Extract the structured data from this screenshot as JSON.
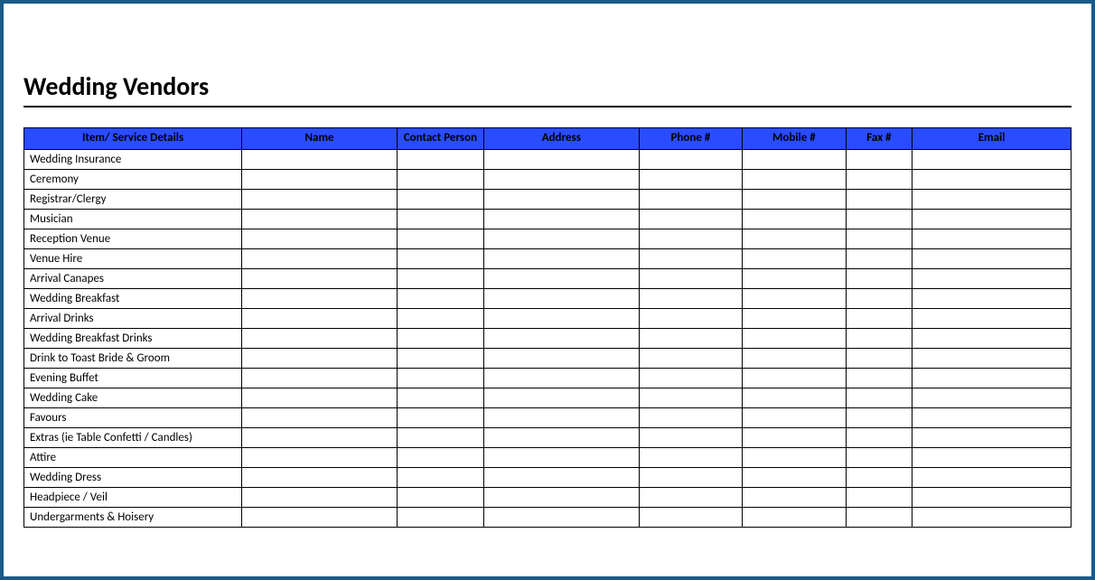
{
  "title": "Wedding Vendors",
  "headers": {
    "item": "Item/ Service Details",
    "name": "Name",
    "contact": "Contact Person",
    "address": "Address",
    "phone": "Phone #",
    "mobile": "Mobile #",
    "fax": "Fax #",
    "email": "Email"
  },
  "rows": [
    {
      "item": "Wedding Insurance",
      "name": "",
      "contact": "",
      "address": "",
      "phone": "",
      "mobile": "",
      "fax": "",
      "email": ""
    },
    {
      "item": "Ceremony",
      "name": "",
      "contact": "",
      "address": "",
      "phone": "",
      "mobile": "",
      "fax": "",
      "email": ""
    },
    {
      "item": "Registrar/Clergy",
      "name": "",
      "contact": "",
      "address": "",
      "phone": "",
      "mobile": "",
      "fax": "",
      "email": ""
    },
    {
      "item": "Musician",
      "name": "",
      "contact": "",
      "address": "",
      "phone": "",
      "mobile": "",
      "fax": "",
      "email": ""
    },
    {
      "item": "Reception Venue",
      "name": "",
      "contact": "",
      "address": "",
      "phone": "",
      "mobile": "",
      "fax": "",
      "email": ""
    },
    {
      "item": "Venue Hire",
      "name": "",
      "contact": "",
      "address": "",
      "phone": "",
      "mobile": "",
      "fax": "",
      "email": ""
    },
    {
      "item": "Arrival Canapes",
      "name": "",
      "contact": "",
      "address": "",
      "phone": "",
      "mobile": "",
      "fax": "",
      "email": ""
    },
    {
      "item": "Wedding Breakfast",
      "name": "",
      "contact": "",
      "address": "",
      "phone": "",
      "mobile": "",
      "fax": "",
      "email": ""
    },
    {
      "item": "Arrival Drinks",
      "name": "",
      "contact": "",
      "address": "",
      "phone": "",
      "mobile": "",
      "fax": "",
      "email": ""
    },
    {
      "item": "Wedding Breakfast Drinks",
      "name": "",
      "contact": "",
      "address": "",
      "phone": "",
      "mobile": "",
      "fax": "",
      "email": ""
    },
    {
      "item": "Drink to Toast Bride & Groom",
      "name": "",
      "contact": "",
      "address": "",
      "phone": "",
      "mobile": "",
      "fax": "",
      "email": ""
    },
    {
      "item": "Evening Buffet",
      "name": "",
      "contact": "",
      "address": "",
      "phone": "",
      "mobile": "",
      "fax": "",
      "email": ""
    },
    {
      "item": "Wedding Cake",
      "name": "",
      "contact": "",
      "address": "",
      "phone": "",
      "mobile": "",
      "fax": "",
      "email": ""
    },
    {
      "item": "Favours",
      "name": "",
      "contact": "",
      "address": "",
      "phone": "",
      "mobile": "",
      "fax": "",
      "email": ""
    },
    {
      "item": "Extras (ie Table Confetti / Candles)",
      "name": "",
      "contact": "",
      "address": "",
      "phone": "",
      "mobile": "",
      "fax": "",
      "email": ""
    },
    {
      "item": "Attire",
      "name": "",
      "contact": "",
      "address": "",
      "phone": "",
      "mobile": "",
      "fax": "",
      "email": ""
    },
    {
      "item": "Wedding Dress",
      "name": "",
      "contact": "",
      "address": "",
      "phone": "",
      "mobile": "",
      "fax": "",
      "email": ""
    },
    {
      "item": "Headpiece / Veil",
      "name": "",
      "contact": "",
      "address": "",
      "phone": "",
      "mobile": "",
      "fax": "",
      "email": ""
    },
    {
      "item": "Undergarments & Hoisery",
      "name": "",
      "contact": "",
      "address": "",
      "phone": "",
      "mobile": "",
      "fax": "",
      "email": ""
    }
  ]
}
